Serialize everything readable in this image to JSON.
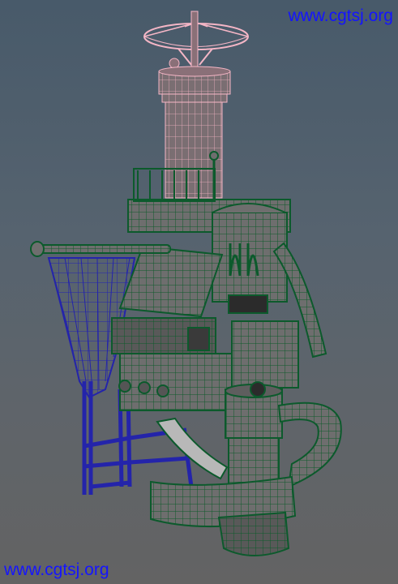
{
  "watermarks": {
    "top": "www.cgtsj.org",
    "bottom": "www.cgtsj.org"
  },
  "colors": {
    "wire_green": "#0c5a2c",
    "wire_pink": "#f4b8c8",
    "wire_blue": "#2020a8",
    "mesh_gray": "#6f6f6f",
    "watermark_blue": "#1414ff"
  }
}
